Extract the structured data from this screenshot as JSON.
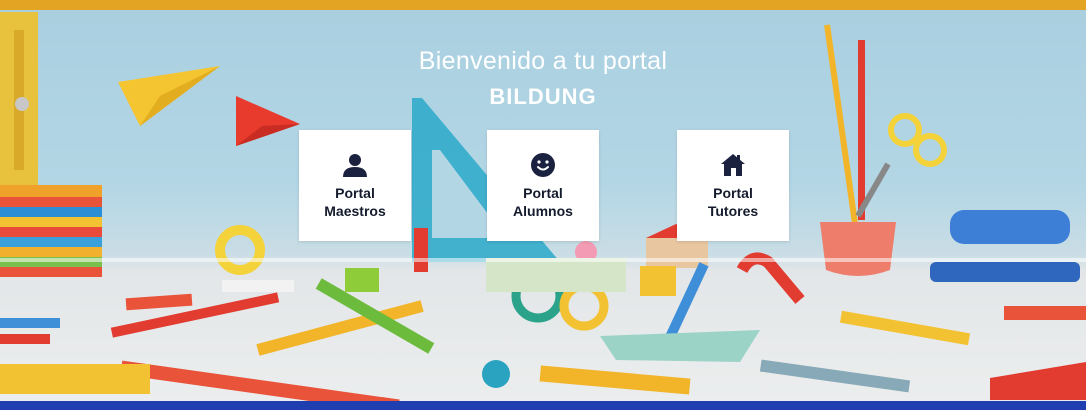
{
  "hero": {
    "welcome": "Bienvenido a tu portal",
    "brand": "BILDUNG"
  },
  "portals": [
    {
      "line1": "Portal",
      "line2": "Maestros",
      "icon": "user-icon"
    },
    {
      "line1": "Portal",
      "line2": "Alumnos",
      "icon": "smiley-icon"
    },
    {
      "line1": "Portal",
      "line2": "Tutores",
      "icon": "home-icon"
    }
  ],
  "colors": {
    "top_bar": "#e3a323",
    "bottom_bar": "#1f3fb0",
    "icon": "#1b2240",
    "label": "#141b2d"
  }
}
